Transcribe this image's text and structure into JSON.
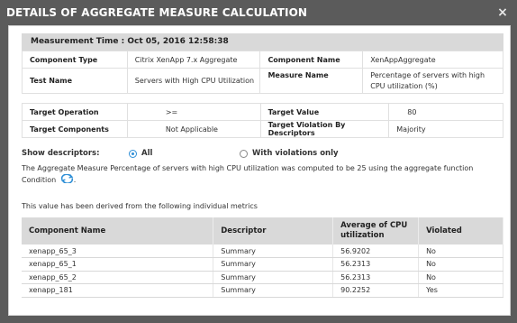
{
  "dialog": {
    "title": "DETAILS OF AGGREGATE MEASURE CALCULATION",
    "close_label": "×",
    "measurement_time": "Measurement Time : Oct 05, 2016 12:58:38",
    "info_rows": [
      {
        "k1": "Component Type",
        "v1": "Citrix XenApp 7.x Aggregate",
        "k2": "Component Name",
        "v2": "XenAppAggregate"
      },
      {
        "k1": "Test Name",
        "v1": "Servers with High CPU Utilization",
        "k2": "Measure Name",
        "v2": "Percentage of servers with high CPU utilization (%)"
      }
    ],
    "target_rows": [
      {
        "k1": "Target Operation",
        "v1": ">=",
        "k2": "Target Value",
        "v2": "80"
      },
      {
        "k1": "Target Components",
        "v1": "Not Applicable",
        "k2": "Target Violation By Descriptors",
        "v2": "Majority"
      }
    ],
    "show_descriptors_label": "Show descriptors:",
    "radio_all": "All",
    "radio_violations": "With violations only",
    "summary_text": "The Aggregate Measure Percentage of servers with high CPU utilization was computed to be 25 using the aggregate function",
    "condition_label": "Condition",
    "condition_suffix": ".",
    "derived_text": "This value has been derived from the following individual metrics",
    "metrics_headers": [
      "Component Name",
      "Descriptor",
      "Average of CPU utilization",
      "Violated"
    ],
    "metrics_rows": [
      [
        "xenapp_65_3",
        "Summary",
        "56.9202",
        "No"
      ],
      [
        "xenapp_65_1",
        "Summary",
        "56.2313",
        "No"
      ],
      [
        "xenapp_65_2",
        "Summary",
        "56.2313",
        "No"
      ],
      [
        "xenapp_181",
        "Summary",
        "90.2252",
        "Yes"
      ]
    ]
  },
  "colors": {
    "accent": "#2f8fd6",
    "titlebar": "#5b5b5b",
    "header_bg": "#d9d9d9"
  },
  "icons": {
    "close": "close-icon",
    "condition": "refresh-cycle-icon"
  }
}
